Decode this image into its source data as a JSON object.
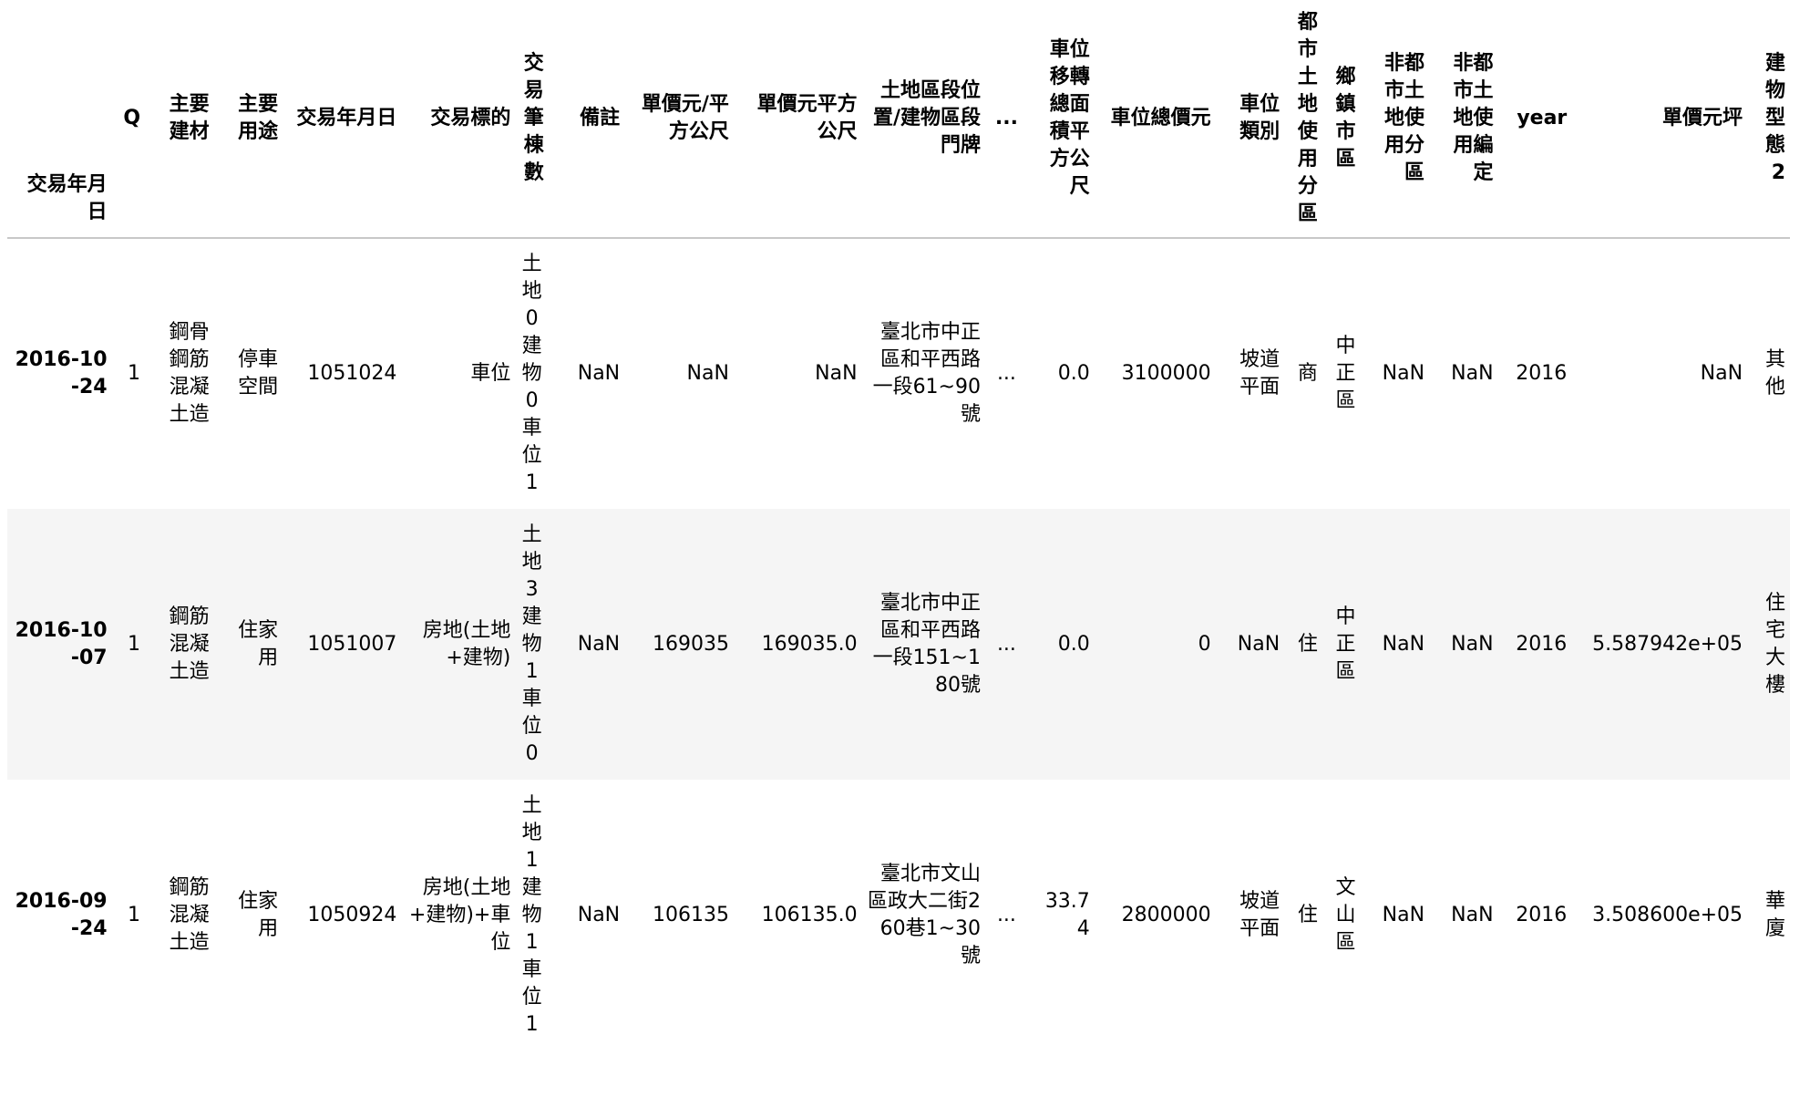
{
  "table": {
    "index_name": "交易年月日",
    "columns": [
      "Q",
      "主要建材",
      "主要用途",
      "交易年月日",
      "交易標的",
      "交易筆棟數",
      "備註",
      "單價元/平方公尺",
      "單價元平方公尺",
      "土地區段位置/建物區段門牌",
      "...",
      "車位移轉總面積平方公尺",
      "車位總價元",
      "車位類別",
      "都市土地使用分區",
      "鄉鎮市區",
      "非都市土地使用分區",
      "非都市土地使用編定",
      "year",
      "單價元坪",
      "建物型態2"
    ],
    "rows": [
      {
        "index": "2016-10-24",
        "cells": [
          "1",
          "鋼骨鋼筋混凝土造",
          "停車空間",
          "1051024",
          "車位",
          "土地0建物0車位1",
          "NaN",
          "NaN",
          "NaN",
          "臺北市中正區和平西路一段61~90號",
          "...",
          "0.0",
          "3100000",
          "坡道平面",
          "商",
          "中正區",
          "NaN",
          "NaN",
          "2016",
          "NaN",
          "其他"
        ]
      },
      {
        "index": "2016-10-07",
        "cells": [
          "1",
          "鋼筋混凝土造",
          "住家用",
          "1051007",
          "房地(土地+建物)",
          "土地3建物1車位0",
          "NaN",
          "169035",
          "169035.0",
          "臺北市中正區和平西路一段151~180號",
          "...",
          "0.0",
          "0",
          "NaN",
          "住",
          "中正區",
          "NaN",
          "NaN",
          "2016",
          "5.587942e+05",
          "住宅大樓"
        ]
      },
      {
        "index": "2016-09-24",
        "cells": [
          "1",
          "鋼筋混凝土造",
          "住家用",
          "1050924",
          "房地(土地+建物)+車位",
          "土地1建物1車位1",
          "NaN",
          "106135",
          "106135.0",
          "臺北市文山區政大二街260巷1~30號",
          "...",
          "33.74",
          "2800000",
          "坡道平面",
          "住",
          "文山區",
          "NaN",
          "NaN",
          "2016",
          "3.508600e+05",
          "華廈"
        ]
      }
    ]
  }
}
